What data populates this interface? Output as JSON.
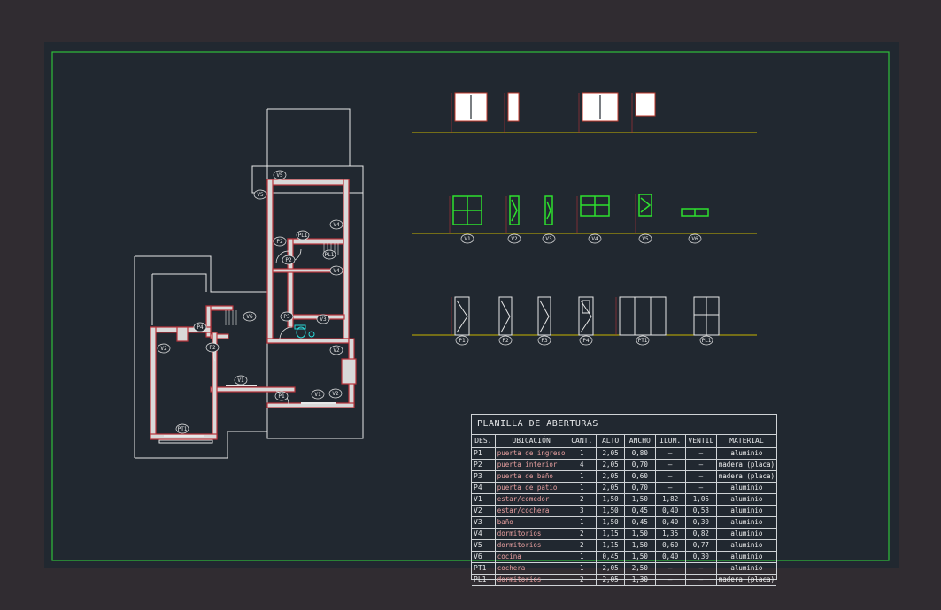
{
  "colors": {
    "background": "#302c31",
    "canvas": "#212830",
    "frame": "#2fbf3a",
    "wall": "#b8333a",
    "wall_fill": "#d9d9d9",
    "outline": "#e8e8e8",
    "ground_line": "#c8b400",
    "glass": "#2ee02e",
    "table_text": "#e6e8ea"
  },
  "plan": {
    "tags": [
      "P1",
      "P2",
      "P2",
      "P2",
      "P3",
      "P4",
      "V1",
      "V1",
      "V2",
      "V2",
      "V2",
      "V3",
      "V4",
      "V4",
      "V5",
      "V5",
      "V6",
      "PL1",
      "PL1",
      "PT1"
    ]
  },
  "elevations": {
    "row2_labels": [
      "V1",
      "V2",
      "V3",
      "V4",
      "V5",
      "V6"
    ],
    "row3_labels": [
      "P1",
      "P2",
      "P3",
      "P4",
      "PT1",
      "PL1"
    ]
  },
  "schedule": {
    "title": "PLANILLA DE ABERTURAS",
    "headers": [
      "DES.",
      "UBICACIÓN",
      "CANT.",
      "ALTO",
      "ANCHO",
      "ILUM.",
      "VENTIL",
      "MATERIAL"
    ],
    "rows": [
      [
        "P1",
        "puerta de ingreso",
        "1",
        "2,05",
        "0,80",
        "—",
        "—",
        "aluminio"
      ],
      [
        "P2",
        "puerta interior",
        "4",
        "2,05",
        "0,70",
        "—",
        "—",
        "madera (placa)"
      ],
      [
        "P3",
        "puerta de baño",
        "1",
        "2,05",
        "0,60",
        "—",
        "—",
        "madera (placa)"
      ],
      [
        "P4",
        "puerta de patio",
        "1",
        "2,05",
        "0,70",
        "—",
        "—",
        "aluminio"
      ],
      [
        "V1",
        "estar/comedor",
        "2",
        "1,50",
        "1,50",
        "1,82",
        "1,06",
        "aluminio"
      ],
      [
        "V2",
        "estar/cochera",
        "3",
        "1,50",
        "0,45",
        "0,40",
        "0,58",
        "aluminio"
      ],
      [
        "V3",
        "baño",
        "1",
        "1,50",
        "0,45",
        "0,40",
        "0,30",
        "aluminio"
      ],
      [
        "V4",
        "dormitorios",
        "2",
        "1,15",
        "1,50",
        "1,35",
        "0,82",
        "aluminio"
      ],
      [
        "V5",
        "dormitorios",
        "2",
        "1,15",
        "1,50",
        "0,60",
        "0,77",
        "aluminio"
      ],
      [
        "V6",
        "cocina",
        "1",
        "0,45",
        "1,50",
        "0,40",
        "0,30",
        "aluminio"
      ],
      [
        "PT1",
        "cochera",
        "1",
        "2,05",
        "2,50",
        "—",
        "—",
        "aluminio"
      ],
      [
        "PL1",
        "dormitorios",
        "2",
        "2,05",
        "1,30",
        "—",
        "—",
        "madera (placa)"
      ]
    ]
  }
}
